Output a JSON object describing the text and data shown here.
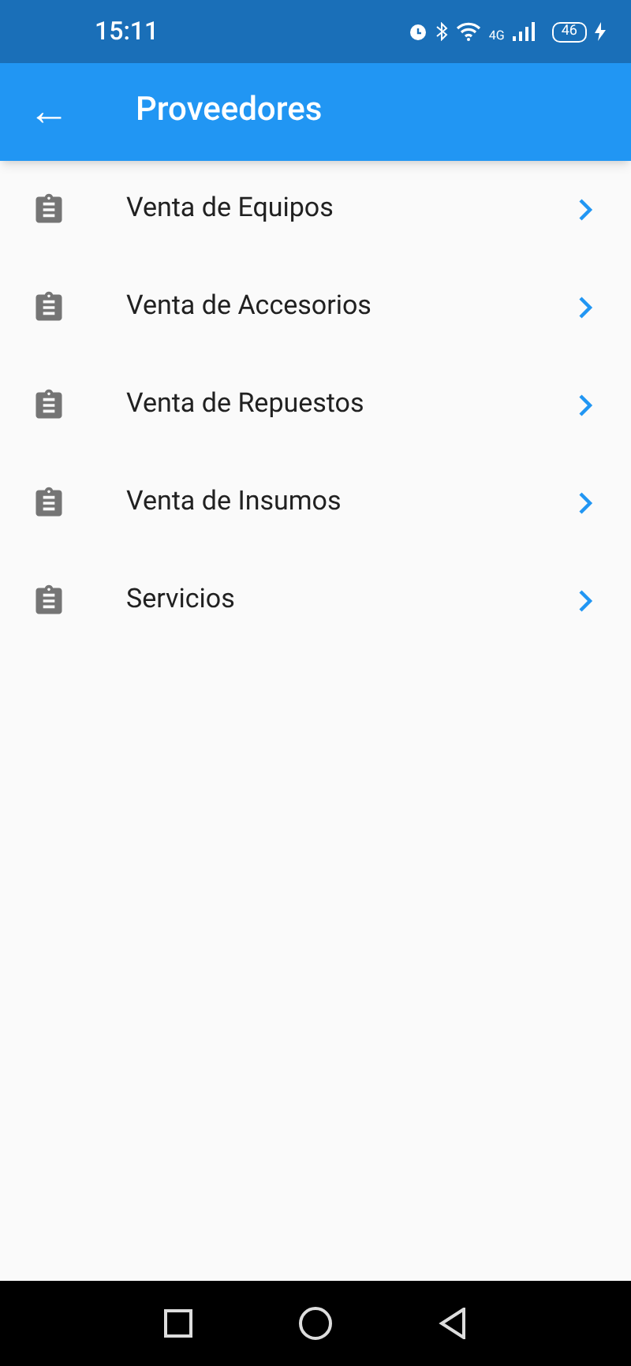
{
  "status_bar": {
    "time": "15:11",
    "network": "4G",
    "battery": "46"
  },
  "app_bar": {
    "back": "←",
    "title": "Proveedores"
  },
  "items": [
    {
      "label": "Venta de Equipos"
    },
    {
      "label": "Venta de Accesorios"
    },
    {
      "label": "Venta de Repuestos"
    },
    {
      "label": "Venta de Insumos"
    },
    {
      "label": "Servicios"
    }
  ]
}
